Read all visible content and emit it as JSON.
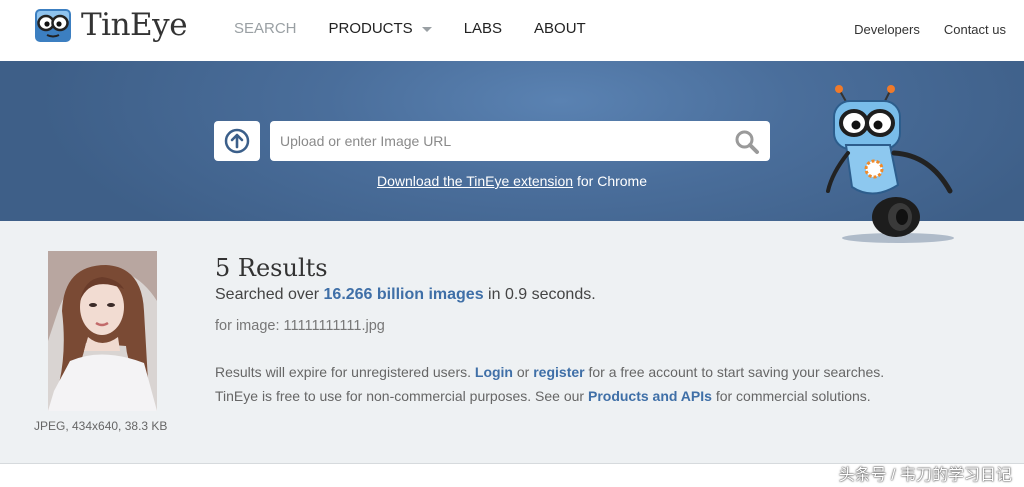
{
  "header": {
    "logo_text": "TinEye",
    "nav": [
      {
        "label": "SEARCH"
      },
      {
        "label": "PRODUCTS"
      },
      {
        "label": "LABS"
      },
      {
        "label": "ABOUT"
      }
    ],
    "links": {
      "developers": "Developers",
      "contact": "Contact us"
    }
  },
  "hero": {
    "search_placeholder": "Upload or enter Image URL",
    "extension_link": "Download the TinEye extension",
    "extension_suffix": " for Chrome"
  },
  "results": {
    "title": "5 Results",
    "summary_prefix": "Searched over ",
    "summary_count": "16.266 billion images",
    "summary_suffix": " in 0.9 seconds.",
    "for_image": "for image: 11111111111.jpg",
    "image_meta": "JPEG, 434x640, 38.3 KB",
    "note1_prefix": "Results will expire for unregistered users. ",
    "note1_login": "Login",
    "note1_or": " or ",
    "note1_register": "register",
    "note1_suffix": " for a free account to start saving your searches.",
    "note2_prefix": "TinEye is free to use for non-commercial purposes. See our ",
    "note2_link": "Products and APIs",
    "note2_suffix": " for commercial solutions."
  },
  "watermark": "头条号 / 韦刀的学习日记",
  "colors": {
    "hero": "#4a6e9b",
    "accent_link": "#3f6fa7",
    "page_bg": "#eef1f3"
  }
}
